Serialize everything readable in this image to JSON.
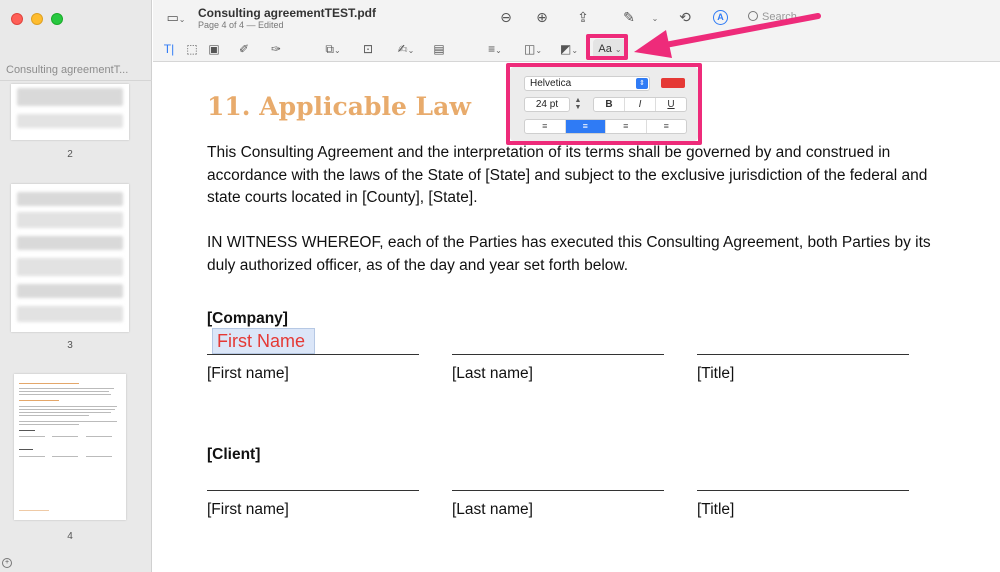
{
  "window": {
    "doc_title": "Consulting agreementTEST.pdf",
    "doc_subtitle": "Page 4 of 4 — Edited",
    "search_placeholder": "Search"
  },
  "sidebar": {
    "title": "Consulting agreementT...",
    "pages": [
      "2",
      "3",
      "4"
    ]
  },
  "toolbar": {
    "aa_label": "Aa",
    "icons": [
      "sidebar-toggle-icon",
      "zoom-out-icon",
      "zoom-in-icon",
      "share-icon",
      "pen-icon",
      "rotate-icon",
      "markup-icon",
      "search-icon",
      "text-select-icon",
      "rect-select-icon",
      "redact-icon",
      "sketch-icon",
      "draw-icon",
      "shapes-icon",
      "textbox-icon",
      "sign-icon",
      "note-icon",
      "line-style-icon",
      "border-color-icon",
      "fill-color-icon",
      "text-style-icon"
    ]
  },
  "text_popup": {
    "font": "Helvetica",
    "size": "24 pt",
    "bold": "B",
    "italic": "I",
    "underline": "U",
    "color": "#e53935",
    "align_left": "≡",
    "align_center": "≡",
    "align_right": "≡",
    "align_justify": "≡"
  },
  "document": {
    "heading": "11. Applicable Law",
    "para1": "This Consulting Agreement and the interpretation of its terms shall be governed by and construed in accordance with the laws of the State of [State] and subject to the exclusive jurisdiction of the federal and state courts located in [County], [State].",
    "para2": "IN WITNESS WHEREOF, each of the Parties has executed this Consulting Agreement, both Parties by its duly authorized officer, as of the day and year set forth below.",
    "company_label": "[Company]",
    "client_label": "[Client]",
    "first_name_field": "First Name",
    "sig_first": "[First name]",
    "sig_last": "[Last name]",
    "sig_title": "[Title]"
  },
  "colors": {
    "highlight": "#ee2b7a",
    "heading": "#e8ab6c",
    "accent": "#2f7bf5"
  }
}
